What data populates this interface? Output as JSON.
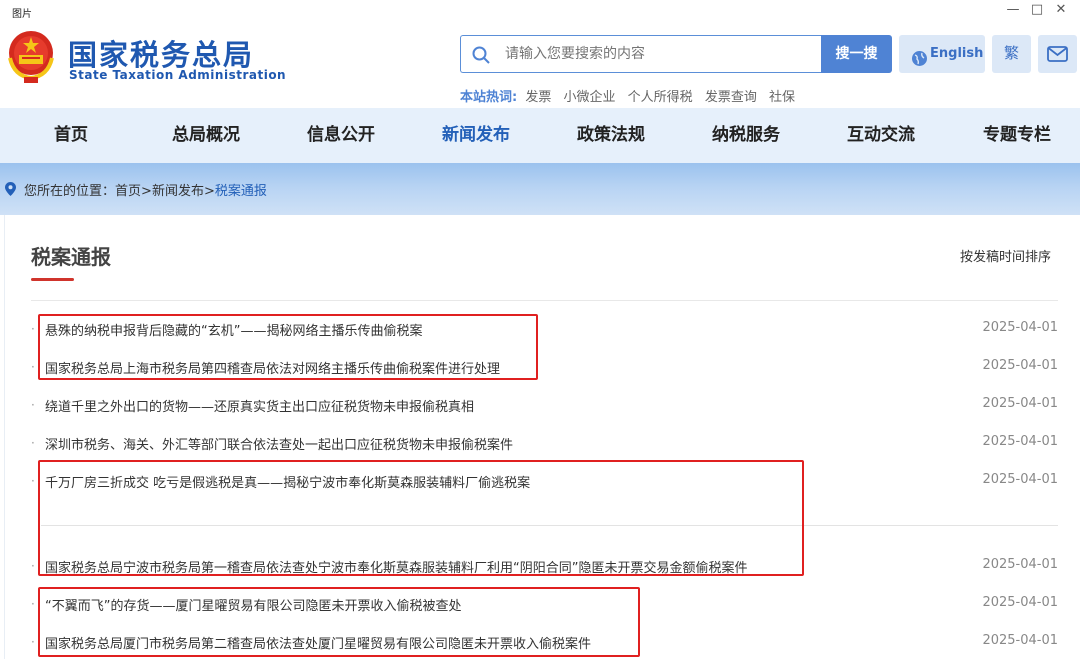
{
  "window": {
    "title": "图片",
    "minimize": "—",
    "maximize": "□",
    "close": "✕"
  },
  "header": {
    "logo_cn": "国家税务总局",
    "logo_en": "State Taxation Administration",
    "search_placeholder": "请输入您要搜索的内容",
    "search_button": "搜一搜",
    "english_label": "English",
    "traditional_label": "繁",
    "hot_label": "本站热词:",
    "hot_words": [
      "发票",
      "小微企业",
      "个人所得税",
      "发票查询",
      "社保"
    ]
  },
  "nav": {
    "items": [
      "首页",
      "总局概况",
      "信息公开",
      "新闻发布",
      "政策法规",
      "纳税服务",
      "互动交流",
      "专题专栏"
    ],
    "active": "新闻发布"
  },
  "breadcrumb": {
    "label": "您所在的位置：",
    "home": "首页",
    "sep1": ">",
    "section": "新闻发布",
    "sep2": ">",
    "current": "税案通报"
  },
  "section": {
    "title": "税案通报",
    "sort_label": "按发稿时间排序"
  },
  "articles": [
    {
      "bullet": "·",
      "title": "悬殊的纳税申报背后隐藏的“玄机”——揭秘网络主播乐传曲偷税案",
      "date": "2025-04-01"
    },
    {
      "bullet": "·",
      "title": "国家税务总局上海市税务局第四稽查局依法对网络主播乐传曲偷税案件进行处理",
      "date": "2025-04-01"
    },
    {
      "bullet": "·",
      "title": "绕道千里之外出口的货物——还原真实货主出口应征税货物未申报偷税真相",
      "date": "2025-04-01"
    },
    {
      "bullet": "·",
      "title": "深圳市税务、海关、外汇等部门联合依法查处一起出口应征税货物未申报偷税案件",
      "date": "2025-04-01"
    },
    {
      "bullet": "·",
      "title": "千万厂房三折成交 吃亏是假逃税是真——揭秘宁波市奉化斯莫森服装辅料厂偷逃税案",
      "date": "2025-04-01"
    },
    {
      "bullet": "·",
      "title": "国家税务总局宁波市税务局第一稽查局依法查处宁波市奉化斯莫森服装辅料厂利用“阴阳合同”隐匿未开票交易金额偷税案件",
      "date": "2025-04-01"
    },
    {
      "bullet": "·",
      "title": "“不翼而飞”的存货——厦门星曜贸易有限公司隐匿未开票收入偷税被查处",
      "date": "2025-04-01"
    },
    {
      "bullet": "·",
      "title": "国家税务总局厦门市税务局第二稽查局依法查处厦门星曜贸易有限公司隐匿未开票收入偷税案件",
      "date": "2025-04-01"
    }
  ],
  "colors": {
    "brand": "#1f58b0",
    "accent": "#4f83d4",
    "highlight_box": "#e02020",
    "underline": "#d0342c"
  },
  "icons": [
    "emblem-icon",
    "search-icon",
    "globe-icon",
    "mail-icon",
    "location-pin-icon"
  ]
}
